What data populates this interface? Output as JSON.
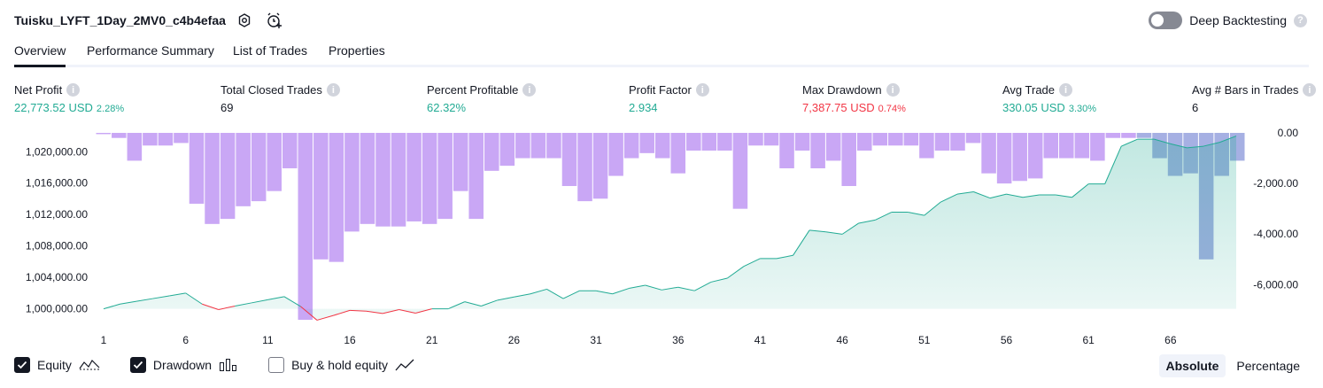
{
  "header": {
    "title": "Tuisku_LYFT_1Day_2MV0_c4b4efaa",
    "deep_backtesting_label": "Deep Backtesting",
    "deep_backtesting_on": false
  },
  "tabs": [
    {
      "label": "Overview",
      "active": true
    },
    {
      "label": "Performance Summary",
      "active": false
    },
    {
      "label": "List of Trades",
      "active": false
    },
    {
      "label": "Properties",
      "active": false
    }
  ],
  "metrics": {
    "net_profit": {
      "label": "Net Profit",
      "value": "22,773.52 USD",
      "pct": "2.28%"
    },
    "total_closed_trades": {
      "label": "Total Closed Trades",
      "value": "69"
    },
    "percent_profitable": {
      "label": "Percent Profitable",
      "value": "62.32%"
    },
    "profit_factor": {
      "label": "Profit Factor",
      "value": "2.934"
    },
    "max_drawdown": {
      "label": "Max Drawdown",
      "value": "7,387.75 USD",
      "pct": "0.74%"
    },
    "avg_trade": {
      "label": "Avg Trade",
      "value": "330.05 USD",
      "pct": "3.30%"
    },
    "avg_bars": {
      "label": "Avg # Bars in Trades",
      "value": "6"
    }
  },
  "legend": {
    "equity_label": "Equity",
    "drawdown_label": "Drawdown",
    "buy_hold_label": "Buy & hold equity",
    "equity_checked": true,
    "drawdown_checked": true,
    "buy_hold_checked": false
  },
  "scale": {
    "absolute_label": "Absolute",
    "percentage_label": "Percentage",
    "active": "absolute"
  },
  "colors": {
    "equity_up": "#22ab94",
    "equity_down": "#f23645",
    "drawdown": "#c9a7f5",
    "drawdown_overlap": "#a6b0e3"
  },
  "chart_data": {
    "type": "line",
    "x_ticks": [
      1,
      6,
      11,
      16,
      21,
      26,
      31,
      36,
      41,
      46,
      51,
      56,
      61,
      66
    ],
    "left_ticks": [
      "1,000,000.00",
      "1,004,000.00",
      "1,008,000.00",
      "1,012,000.00",
      "1,016,000.00",
      "1,020,000.00"
    ],
    "left_tick_values": [
      1000000,
      1004000,
      1008000,
      1012000,
      1016000,
      1020000
    ],
    "right_ticks": [
      "0.00",
      "-2,000.00",
      "-4,000.00",
      "-6,000.00"
    ],
    "right_tick_values": [
      0,
      -2000,
      -4000,
      -6000
    ],
    "left_range": [
      998600,
      1022400
    ],
    "right_range": [
      -7387.75,
      0
    ],
    "series": [
      {
        "name": "Equity",
        "values": [
          1000000,
          1000600,
          1000950,
          1001300,
          1001650,
          1002000,
          1000600,
          999900,
          1000350,
          1000750,
          1001150,
          1001550,
          1000300,
          998550,
          999150,
          999800,
          999700,
          999400,
          999900,
          999450,
          1000000,
          1000000,
          1000900,
          1000350,
          1001100,
          1001500,
          1001900,
          1002500,
          1001300,
          1002300,
          1002300,
          1001900,
          1002600,
          1003000,
          1002400,
          1002750,
          1002300,
          1003400,
          1003900,
          1005400,
          1006400,
          1006400,
          1006800,
          1010000,
          1009800,
          1009500,
          1010900,
          1011300,
          1012300,
          1012300,
          1011900,
          1013600,
          1014600,
          1014900,
          1014100,
          1014600,
          1014200,
          1014500,
          1014500,
          1014200,
          1015900,
          1015900,
          1020700,
          1021600,
          1021600,
          1021000,
          1020500,
          1020700,
          1021200,
          1022000
        ]
      },
      {
        "name": "Drawdown",
        "values": [
          -50,
          -200,
          -1100,
          -500,
          -500,
          -400,
          -2800,
          -3600,
          -3400,
          -2900,
          -2700,
          -2300,
          -1400,
          -7387.75,
          -5000,
          -5100,
          -3900,
          -3600,
          -3700,
          -3700,
          -3500,
          -3600,
          -3400,
          -2300,
          -3400,
          -1500,
          -1300,
          -1000,
          -1000,
          -1000,
          -2100,
          -2700,
          -2600,
          -1700,
          -1000,
          -800,
          -1000,
          -1600,
          -700,
          -700,
          -700,
          -3000,
          -500,
          -500,
          -1400,
          -700,
          -1400,
          -1100,
          -2100,
          -700,
          -500,
          -500,
          -500,
          -1000,
          -700,
          -700,
          -400,
          -1600,
          -2000,
          -1900,
          -1800,
          -1000,
          -1000,
          -1000,
          -1100,
          -200,
          -200,
          -200,
          -1000,
          -1700,
          -1600,
          -5000,
          -1700,
          -1100
        ]
      }
    ]
  }
}
